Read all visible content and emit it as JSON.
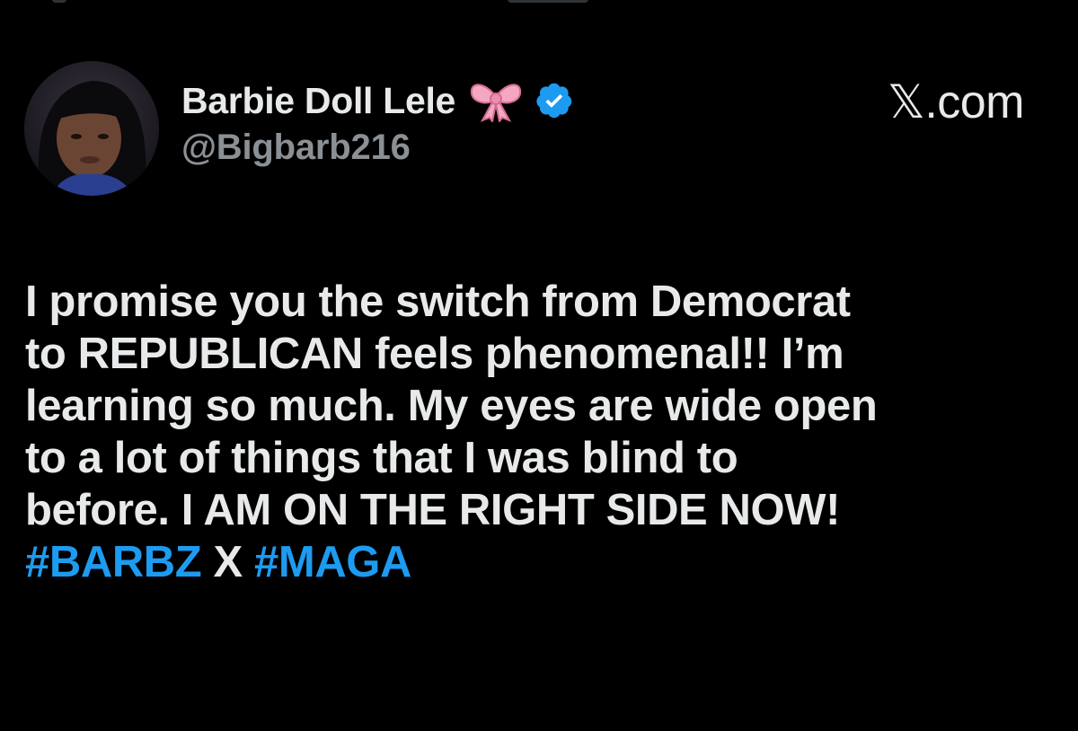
{
  "colors": {
    "background": "#000000",
    "text": "#e7e9ea",
    "secondary_text": "#8b9095",
    "hashtag": "#1d9bf0",
    "verified_badge": "#1d9bf0"
  },
  "post": {
    "author": {
      "display_name": "Barbie Doll Lele",
      "emoji_icon": "pink-bow-icon",
      "verified_icon": "verified-badge-icon",
      "handle": "@Bigbarb216"
    },
    "source_label": "𝕏.com",
    "text_lines": [
      "I promise you the switch from Democrat",
      "to REPUBLICAN feels phenomenal!! I’m",
      "learning so much. My eyes are wide open",
      "to a lot of things that I was blind to",
      "before. I AM ON THE RIGHT SIDE NOW!"
    ],
    "last_line": {
      "hashtag_1": "#BARBZ",
      "middle": " X ",
      "hashtag_2": "#MAGA"
    }
  }
}
